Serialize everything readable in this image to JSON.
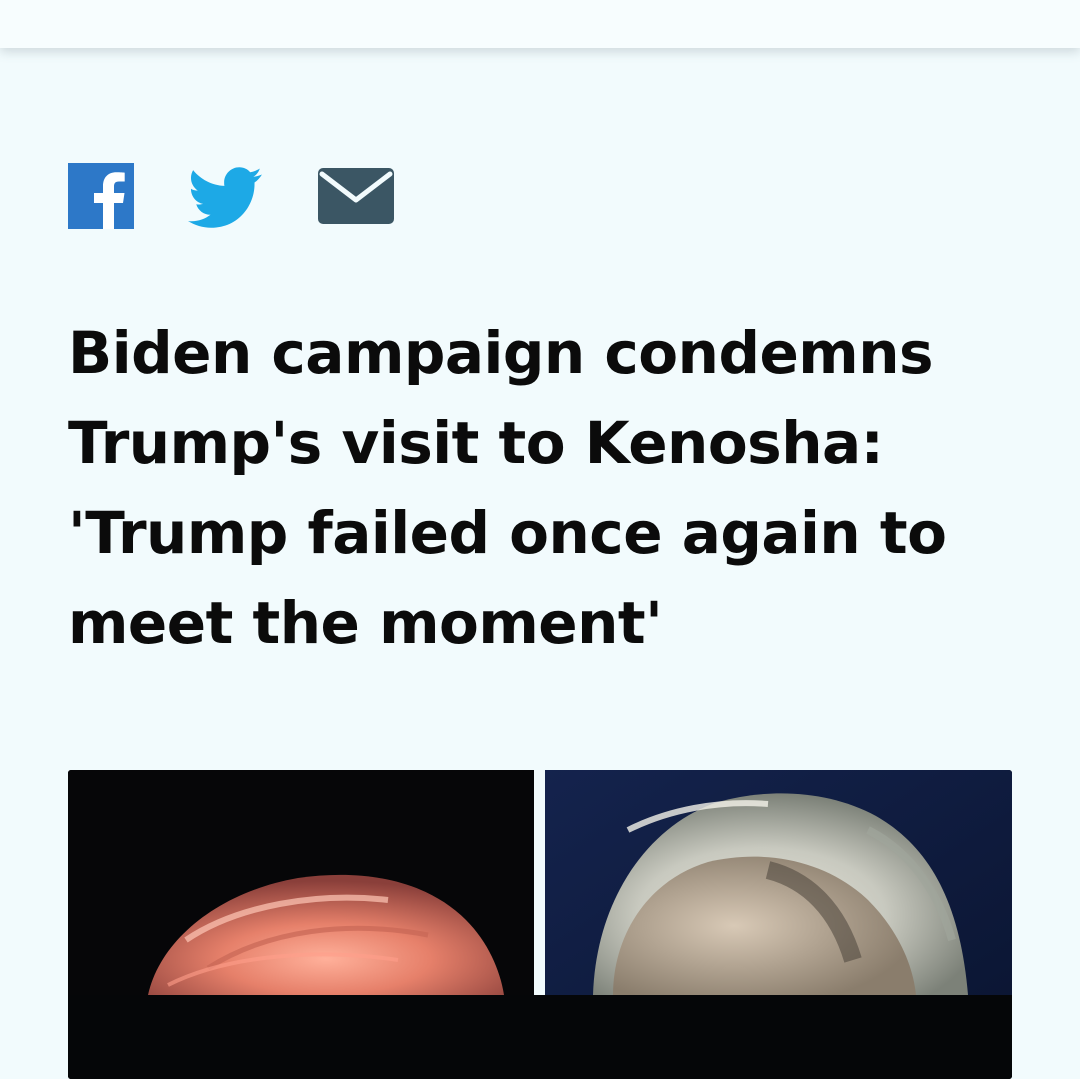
{
  "share": {
    "facebook": {
      "icon": "facebook-icon",
      "color": "#2d78c8"
    },
    "twitter": {
      "icon": "twitter-icon",
      "color": "#1da9e6"
    },
    "email": {
      "icon": "email-icon",
      "color": "#3b5664"
    }
  },
  "article": {
    "headline": "Biden campaign condemns Trump's visit to Kenosha: 'Trump failed once again to meet the moment'"
  },
  "colors": {
    "background": "#f2fbfd",
    "headline_text": "#0b0b0b",
    "photo_dark": "#040508"
  }
}
